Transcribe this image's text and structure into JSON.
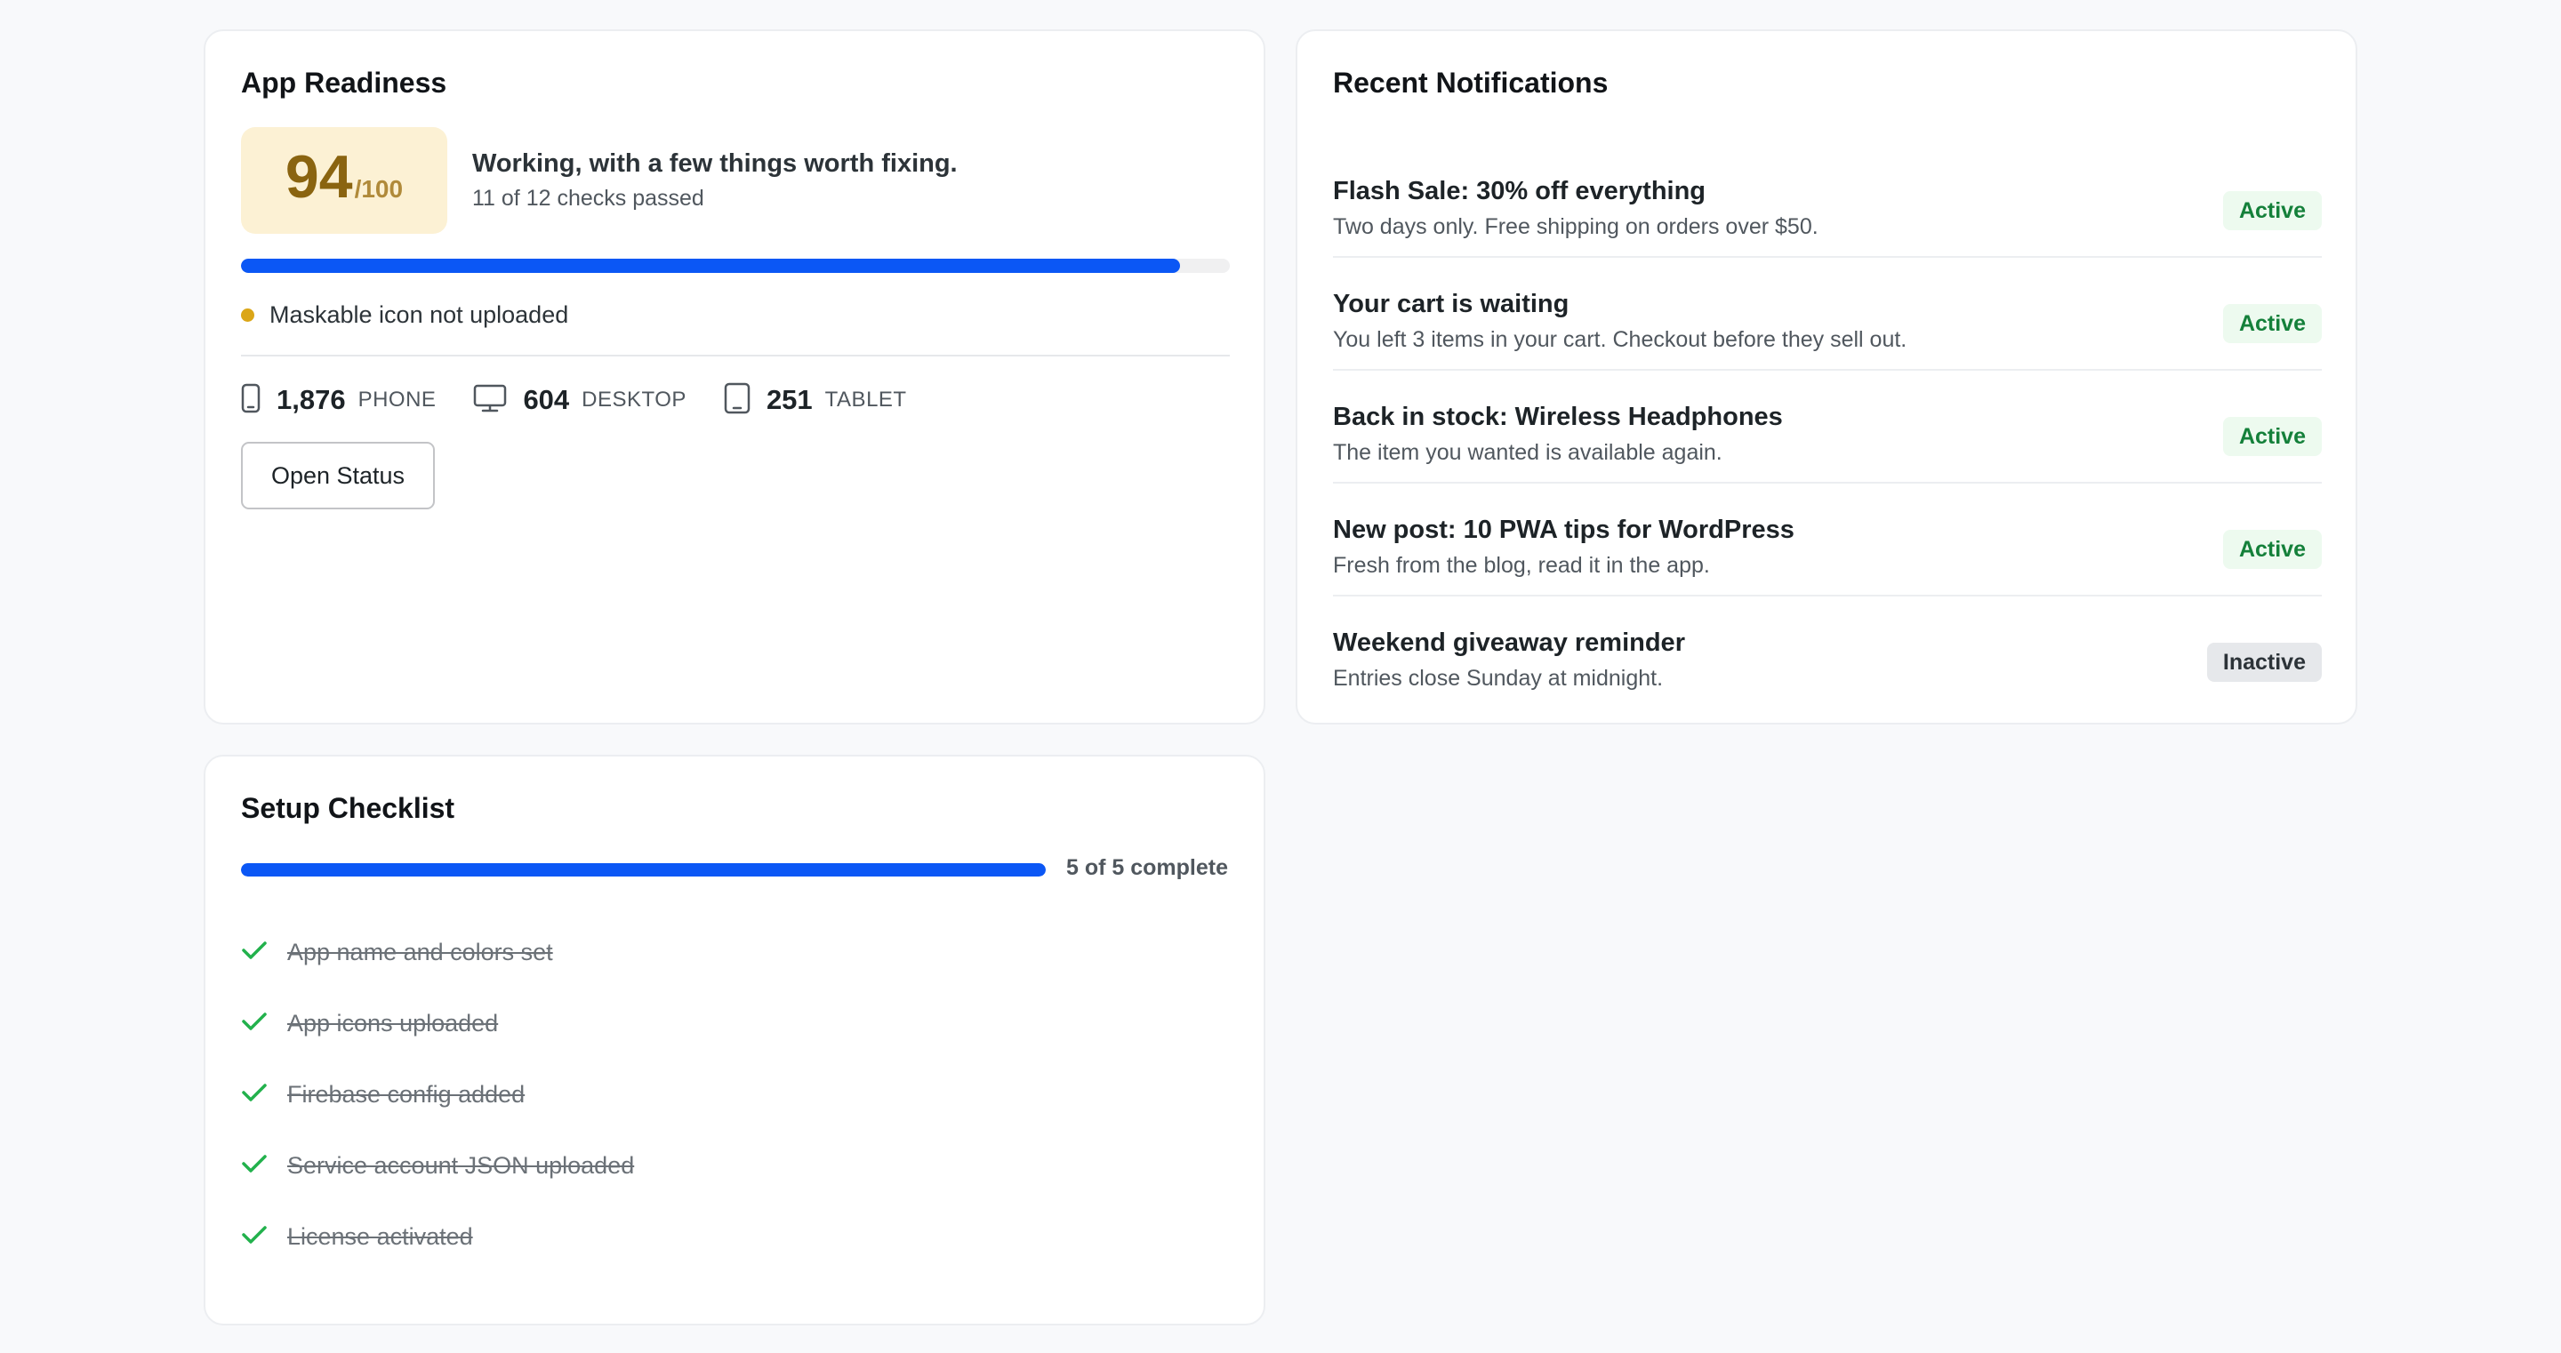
{
  "readiness": {
    "title": "App Readiness",
    "score": "94",
    "score_max": "/100",
    "headline": "Working, with a few things worth fixing.",
    "subline": "11 of 12 checks passed",
    "progress_fraction": 0.95,
    "issue": "Maskable icon not uploaded",
    "devices": [
      {
        "icon": "phone-icon",
        "count": "1,876",
        "label": "PHONE"
      },
      {
        "icon": "desktop-icon",
        "count": "604",
        "label": "DESKTOP"
      },
      {
        "icon": "tablet-icon",
        "count": "251",
        "label": "TABLET"
      }
    ],
    "open_status_label": "Open Status"
  },
  "notifications": {
    "title": "Recent Notifications",
    "items": [
      {
        "title": "Flash Sale: 30% off everything",
        "body": "Two days only. Free shipping on orders over $50.",
        "status": "Active"
      },
      {
        "title": "Your cart is waiting",
        "body": "You left 3 items in your cart. Checkout before they sell out.",
        "status": "Active"
      },
      {
        "title": "Back in stock: Wireless Headphones",
        "body": "The item you wanted is available again.",
        "status": "Active"
      },
      {
        "title": "New post: 10 PWA tips for WordPress",
        "body": "Fresh from the blog, read it in the app.",
        "status": "Active"
      },
      {
        "title": "Weekend giveaway reminder",
        "body": "Entries close Sunday at midnight.",
        "status": "Inactive"
      }
    ]
  },
  "checklist": {
    "title": "Setup Checklist",
    "progress_fraction": 1.0,
    "count_label": "5 of 5 complete",
    "items": [
      {
        "label": "App name and colors set",
        "done": true
      },
      {
        "label": "App icons uploaded",
        "done": true
      },
      {
        "label": "Firebase config added",
        "done": true
      },
      {
        "label": "Service account JSON uploaded",
        "done": true
      },
      {
        "label": "License activated",
        "done": true
      }
    ]
  },
  "colors": {
    "accent": "#0b57f5",
    "score_bg": "#fcf1d4",
    "score_text": "#8a6410",
    "warning_dot": "#dba617",
    "success": "#14803a",
    "check": "#22b14c"
  }
}
